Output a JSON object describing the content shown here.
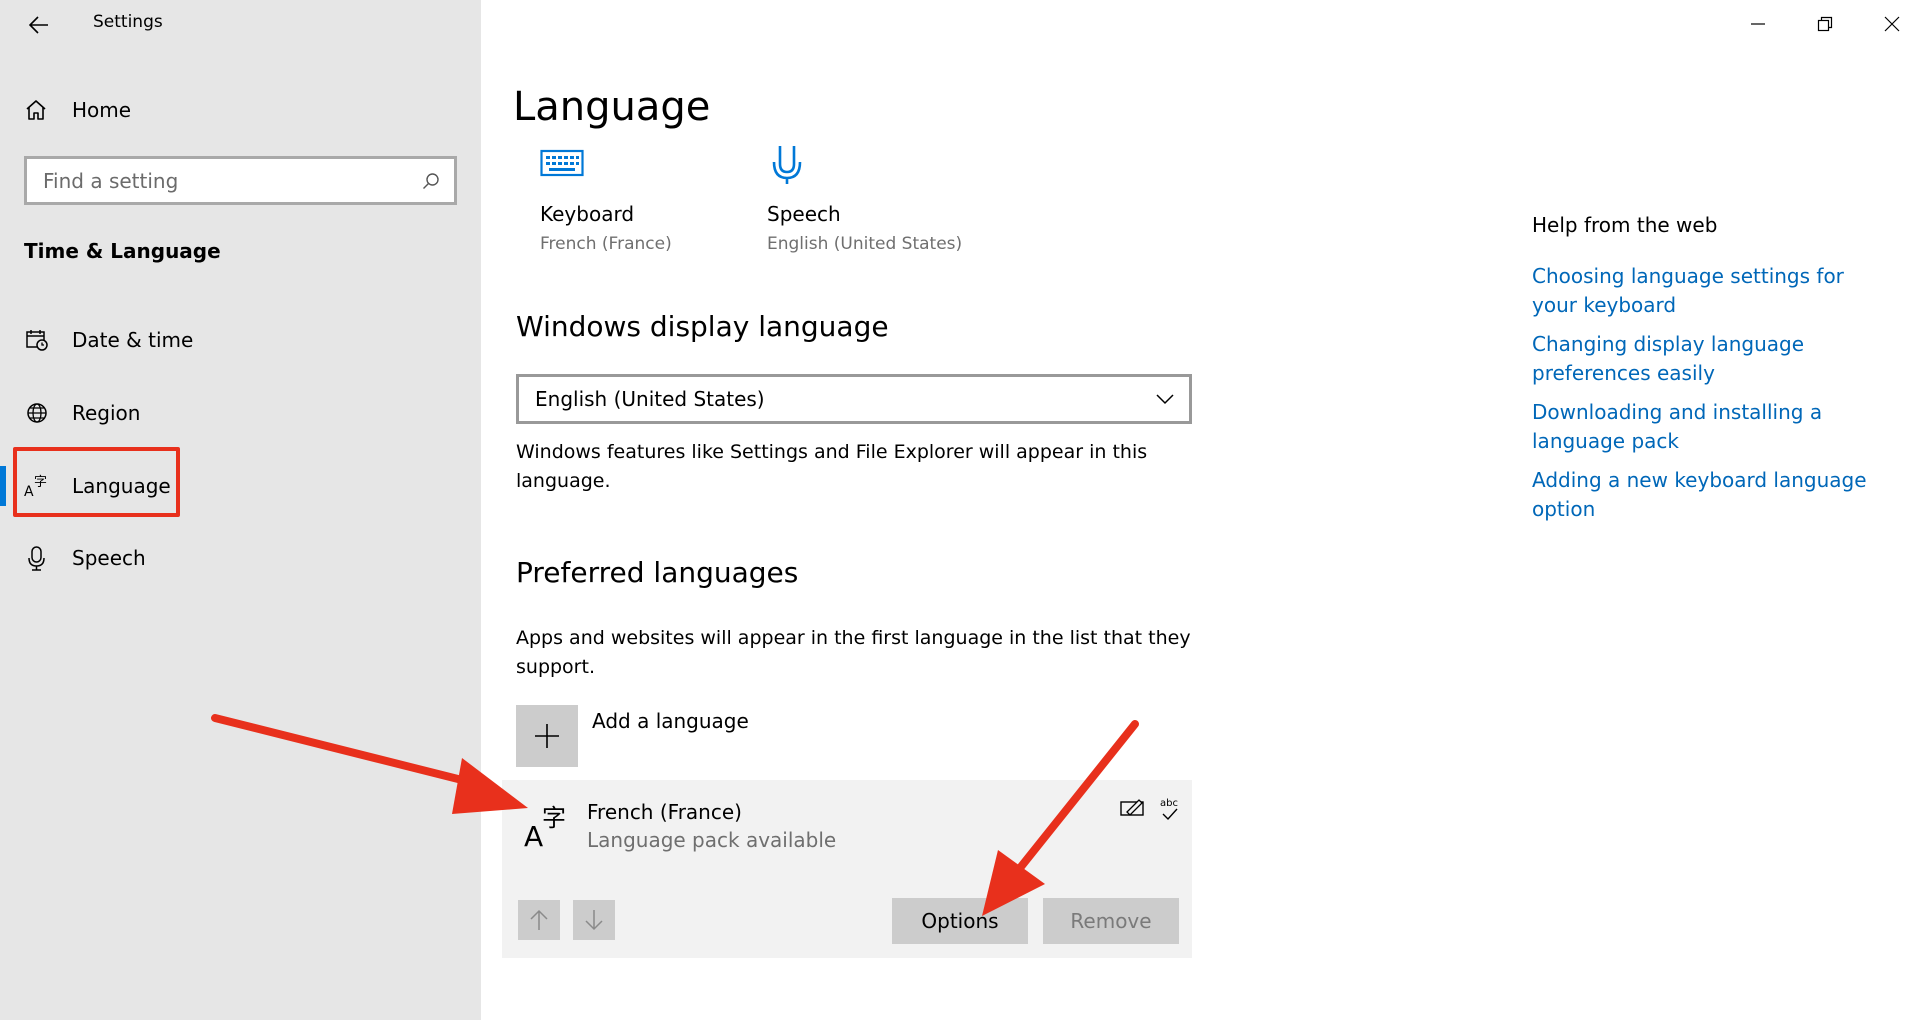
{
  "window": {
    "app_title": "Settings",
    "controls": {
      "minimize": "minimize-icon",
      "restore": "restore-icon",
      "close": "close-icon"
    }
  },
  "sidebar": {
    "home_label": "Home",
    "search_placeholder": "Find a setting",
    "section_heading": "Time & Language",
    "items": [
      {
        "label": "Date & time",
        "icon": "calendar-clock-icon"
      },
      {
        "label": "Region",
        "icon": "globe-icon"
      },
      {
        "label": "Language",
        "icon": "language-icon",
        "selected": true
      },
      {
        "label": "Speech",
        "icon": "microphone-icon"
      }
    ]
  },
  "main": {
    "title": "Language",
    "quick_links": [
      {
        "title": "Keyboard",
        "subtitle": "French (France)",
        "icon": "keyboard-icon"
      },
      {
        "title": "Speech",
        "subtitle": "English (United States)",
        "icon": "speech-microphone-icon"
      }
    ],
    "display_language": {
      "heading": "Windows display language",
      "selected_value": "English (United States)",
      "description": "Windows features like Settings and File Explorer will appear in this language."
    },
    "preferred": {
      "heading": "Preferred languages",
      "description": "Apps and websites will appear in the first language in the list that they support.",
      "add_label": "Add a language",
      "languages": [
        {
          "name": "French (France)",
          "status": "Language pack available",
          "features": [
            "handwriting-icon",
            "spellcheck-icon"
          ],
          "feature_text": "abc",
          "options_label": "Options",
          "remove_label": "Remove"
        }
      ]
    }
  },
  "help": {
    "title": "Help from the web",
    "links": [
      "Choosing language settings for your keyboard",
      "Changing display language preferences easily",
      "Downloading and installing a language pack",
      "Adding a new keyboard language option"
    ]
  },
  "colors": {
    "accent": "#0078d7",
    "link": "#0067b8",
    "annotation_red": "#e8301c",
    "sidebar_bg": "#e6e6e6"
  }
}
